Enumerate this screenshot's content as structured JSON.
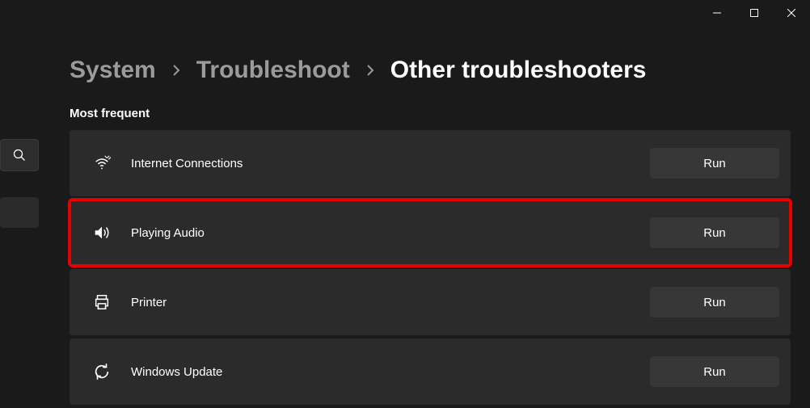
{
  "breadcrumb": {
    "system": "System",
    "troubleshoot": "Troubleshoot",
    "current": "Other troubleshooters"
  },
  "section_label": "Most frequent",
  "run_label": "Run",
  "items": {
    "internet": "Internet Connections",
    "audio": "Playing Audio",
    "printer": "Printer",
    "update": "Windows Update"
  }
}
